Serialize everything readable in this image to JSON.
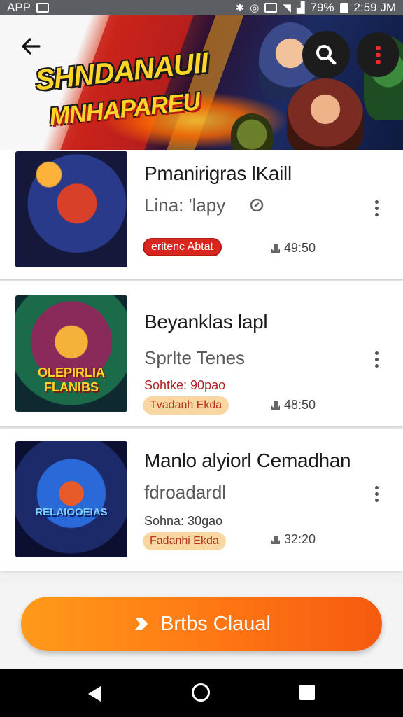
{
  "status_bar": {
    "app_label": "APP",
    "battery": "79%",
    "time": "2:59 JM"
  },
  "header": {
    "banner_line1": "SHNDANAUII",
    "banner_line2": "MNHAPAREU"
  },
  "games": [
    {
      "title": "Pmanirigras lKaill",
      "subtitle": "Lina: 'lapy",
      "meta": "",
      "badge": "eritenc Abtat",
      "badge_style": "red",
      "time": "49:50"
    },
    {
      "title": "Beyanklas lapl",
      "subtitle": "Sprlte Tenes",
      "meta": "Sohtke: 90pao",
      "badge": "Tvadanh Ekda",
      "badge_style": "tan",
      "time": "48:50",
      "thumb_label": "OLEPIRLIA FLANIBS"
    },
    {
      "title": "Manlo alyiorl Cemadhan",
      "subtitle": "fdroadardl",
      "meta": "Sohna: 30gao",
      "badge": "Fadanhi Ekda",
      "badge_style": "tan",
      "time": "32:20",
      "thumb_label": "RELAIOOEIAS"
    }
  ],
  "action_button": {
    "label": "Brtbs Claual"
  },
  "colors": {
    "accent": "#ff7a14",
    "badge_red": "#d9261f",
    "badge_tan": "#f8d7a3"
  }
}
